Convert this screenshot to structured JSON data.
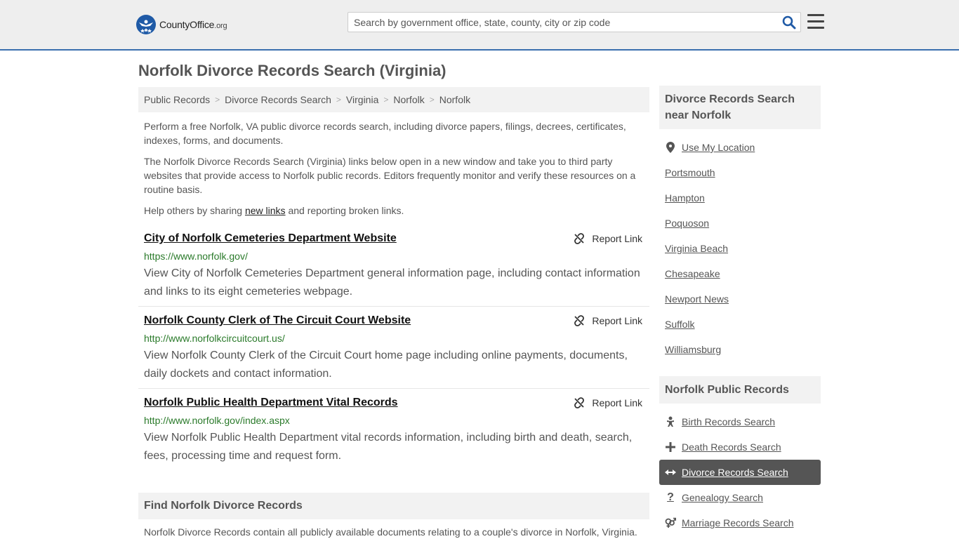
{
  "header": {
    "logo_main": "CountyOffice",
    "logo_suffix": ".org",
    "search_placeholder": "Search by government office, state, county, city or zip code"
  },
  "page_title": "Norfolk Divorce Records Search (Virginia)",
  "breadcrumb": [
    "Public Records",
    "Divorce Records Search",
    "Virginia",
    "Norfolk",
    "Norfolk"
  ],
  "intro": {
    "p1": "Perform a free Norfolk, VA public divorce records search, including divorce papers, filings, decrees, certificates, indexes, forms, and documents.",
    "p2": "The Norfolk Divorce Records Search (Virginia) links below open in a new window and take you to third party websites that provide access to Norfolk public records. Editors frequently monitor and verify these resources on a routine basis.",
    "p3_before": "Help others by sharing ",
    "p3_link": "new links",
    "p3_after": " and reporting broken links."
  },
  "report_label": "Report Link",
  "results": [
    {
      "title": "City of Norfolk Cemeteries Department Website",
      "url": "https://www.norfolk.gov/",
      "desc": "View City of Norfolk Cemeteries Department general information page, including contact information and links to its eight cemeteries webpage."
    },
    {
      "title": "Norfolk County Clerk of The Circuit Court Website",
      "url": "http://www.norfolkcircuitcourt.us/",
      "desc": "View Norfolk County Clerk of the Circuit Court home page including online payments, documents, daily dockets and contact information."
    },
    {
      "title": "Norfolk Public Health Department Vital Records",
      "url": "http://www.norfolk.gov/index.aspx",
      "desc": "View Norfolk Public Health Department vital records information, including birth and death, search, fees, processing time and request form."
    }
  ],
  "find": {
    "heading": "Find Norfolk Divorce Records",
    "text": "Norfolk Divorce Records contain all publicly available documents relating to a couple's divorce in Norfolk, Virginia."
  },
  "sidebar": {
    "nearby_heading": "Divorce Records Search near Norfolk",
    "use_location": "Use My Location",
    "nearby": [
      "Portsmouth",
      "Hampton",
      "Poquoson",
      "Virginia Beach",
      "Chesapeake",
      "Newport News",
      "Suffolk",
      "Williamsburg"
    ],
    "records_heading": "Norfolk Public Records",
    "records": [
      {
        "label": "Birth Records Search",
        "icon": "baby-icon"
      },
      {
        "label": "Death Records Search",
        "icon": "cross-icon"
      },
      {
        "label": "Divorce Records Search",
        "icon": "split-arrows-icon",
        "active": true
      },
      {
        "label": "Genealogy Search",
        "icon": "question-icon"
      },
      {
        "label": "Marriage Records Search",
        "icon": "gender-icon"
      }
    ]
  },
  "colors": {
    "header_bg": "#eeeeee",
    "accent_line": "#3a6fae",
    "url_green": "#2a7a2a",
    "active_bg": "#555555"
  }
}
